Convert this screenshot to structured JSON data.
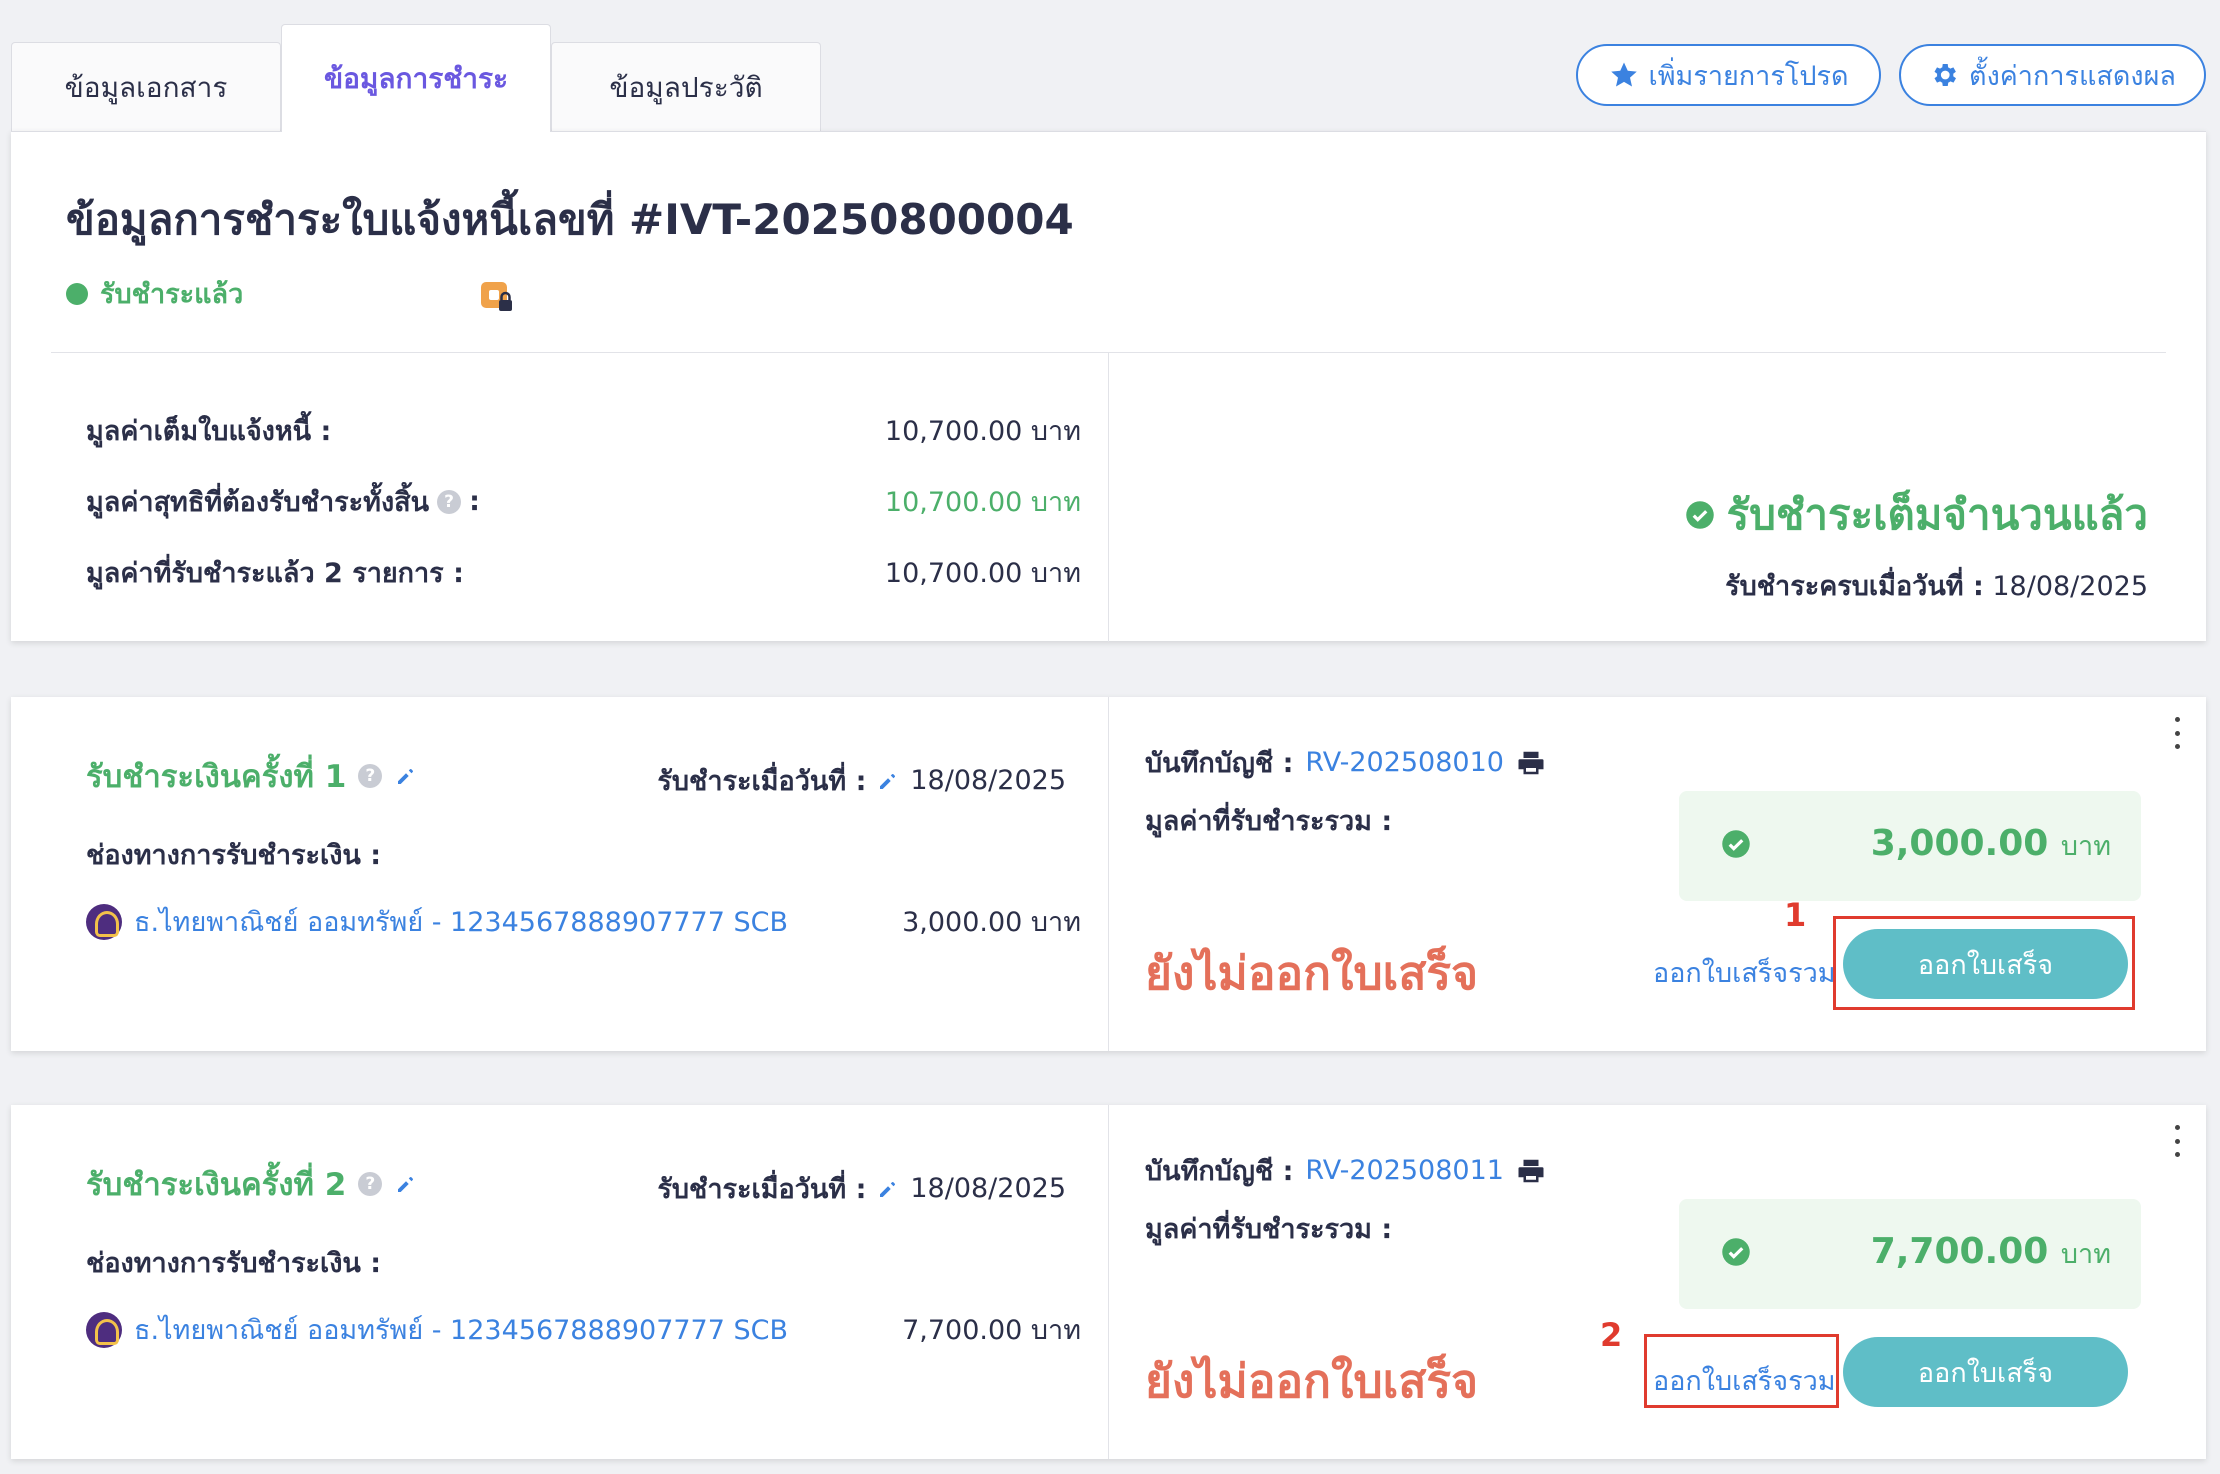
{
  "tabs": [
    "ข้อมูลเอกสาร",
    "ข้อมูลการชำระ",
    "ข้อมูลประวัติ"
  ],
  "actions": {
    "favorite": "เพิ่มรายการโปรด",
    "display_settings": "ตั้งค่าการแสดงผล"
  },
  "colors": {
    "accent": "#3b82e0",
    "success": "#4caf6a",
    "warning": "#e4705a",
    "issue_button": "#5fbec7",
    "tab_active": "#6a58e0",
    "annotation": "#e03b2e"
  },
  "summary": {
    "title": "ข้อมูลการชำระใบแจ้งหนี้เลขที่ #IVT-20250800004",
    "status": "รับชำระแล้ว",
    "rows": [
      {
        "label": "มูลค่าเต็มใบแจ้งหนี้ :",
        "value": "10,700.00 บาท"
      },
      {
        "label": "มูลค่าสุทธิที่ต้องรับชำระทั้งสิ้น",
        "suffix": ":",
        "value": "10,700.00 บาท"
      },
      {
        "label": "มูลค่าที่รับชำระแล้ว 2 รายการ :",
        "value": "10,700.00 บาท"
      }
    ],
    "full_paid": "รับชำระเต็มจำนวนแล้ว",
    "paid_date_label": "รับชำระครบเมื่อวันที่ :",
    "paid_date": "18/08/2025"
  },
  "payments": [
    {
      "title": "รับชำระเงินครั้งที่ 1",
      "date_label": "รับชำระเมื่อวันที่ :",
      "date": "18/08/2025",
      "channel_label": "ช่องทางการรับชำระเงิน :",
      "bank": "ธ.ไทยพาณิชย์ ออมทรัพย์ - 1234567888907777 SCB",
      "bank_amount": "3,000.00 บาท",
      "ledger_label": "บันทึกบัญชี :",
      "ledger_no": "RV-202508010",
      "total_label": "มูลค่าที่รับชำระรวม :",
      "total_amount": "3,000.00",
      "currency": "บาท",
      "receipt_status": "ยังไม่ออกใบเสร็จ",
      "combine_link": "ออกใบเสร็จรวม",
      "issue_button": "ออกใบเสร็จ",
      "marker": "1"
    },
    {
      "title": "รับชำระเงินครั้งที่ 2",
      "date_label": "รับชำระเมื่อวันที่ :",
      "date": "18/08/2025",
      "channel_label": "ช่องทางการรับชำระเงิน :",
      "bank": "ธ.ไทยพาณิชย์ ออมทรัพย์ - 1234567888907777 SCB",
      "bank_amount": "7,700.00 บาท",
      "ledger_label": "บันทึกบัญชี :",
      "ledger_no": "RV-202508011",
      "total_label": "มูลค่าที่รับชำระรวม :",
      "total_amount": "7,700.00",
      "currency": "บาท",
      "receipt_status": "ยังไม่ออกใบเสร็จ",
      "combine_link": "ออกใบเสร็จรวม",
      "issue_button": "ออกใบเสร็จ",
      "marker": "2"
    }
  ]
}
